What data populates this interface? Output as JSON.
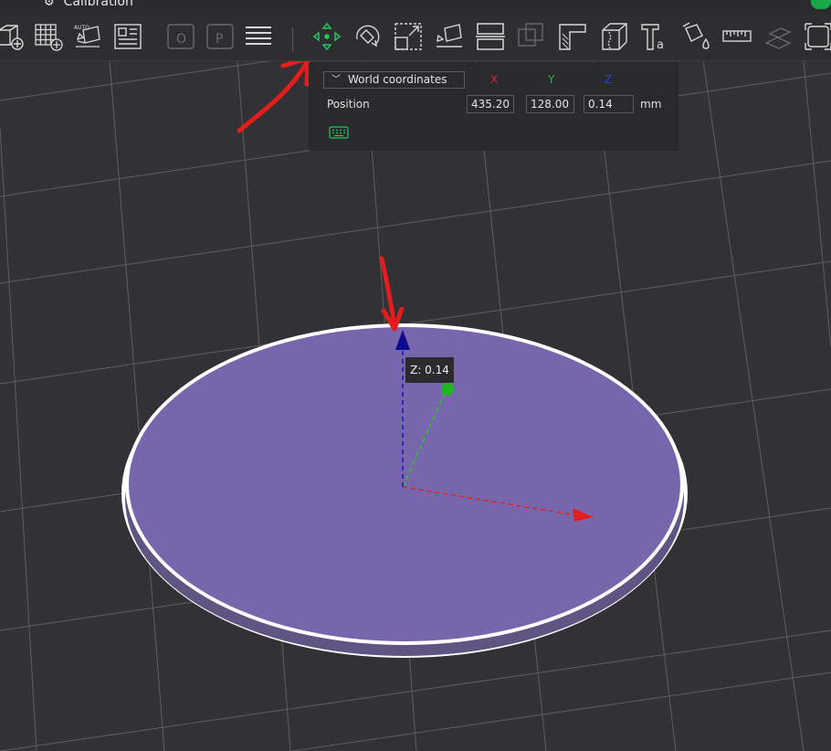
{
  "tab": {
    "label": "Calibration"
  },
  "toolbar": {
    "tools": [
      {
        "id": "add-object",
        "icon": "add-cube-icon"
      },
      {
        "id": "add-plate",
        "icon": "add-plate-grid-icon"
      },
      {
        "id": "auto-orient",
        "icon": "auto-orient-icon",
        "badge": "AUTO"
      },
      {
        "id": "arrange",
        "icon": "arrange-icon"
      },
      {
        "id": "split-objects",
        "icon": "split-objects-icon"
      },
      {
        "id": "split-parts",
        "icon": "split-parts-icon"
      },
      {
        "id": "layers",
        "icon": "layers-icon"
      },
      {
        "id": "move",
        "icon": "move-icon"
      },
      {
        "id": "rotate",
        "icon": "rotate-icon"
      },
      {
        "id": "scale",
        "icon": "scale-icon"
      },
      {
        "id": "lay-on-face",
        "icon": "lay-on-face-icon"
      },
      {
        "id": "cut",
        "icon": "cut-icon"
      },
      {
        "id": "boolean",
        "icon": "boolean-icon"
      },
      {
        "id": "support-paint",
        "icon": "support-paint-icon"
      },
      {
        "id": "seam-paint",
        "icon": "seam-paint-icon"
      },
      {
        "id": "text",
        "icon": "text-icon"
      },
      {
        "id": "color-paint",
        "icon": "color-paint-icon"
      },
      {
        "id": "measure",
        "icon": "measure-ruler-icon"
      },
      {
        "id": "assembly",
        "icon": "assembly-icon"
      },
      {
        "id": "fit-view",
        "icon": "fit-view-icon"
      }
    ]
  },
  "move_panel": {
    "coord_system": "World coordinates",
    "axis_x": "X",
    "axis_y": "Y",
    "axis_z": "Z",
    "position_label": "Position",
    "x": "435.20",
    "y": "128.00",
    "z": "0.14",
    "unit": "mm"
  },
  "tooltip": {
    "text": "Z: 0.14"
  },
  "colors": {
    "background": "#323236",
    "object": "#7866ad",
    "axis_x": "#e02020",
    "axis_y": "#22cc22",
    "axis_z": "#1010a0",
    "annotation": "#e11d1d"
  }
}
